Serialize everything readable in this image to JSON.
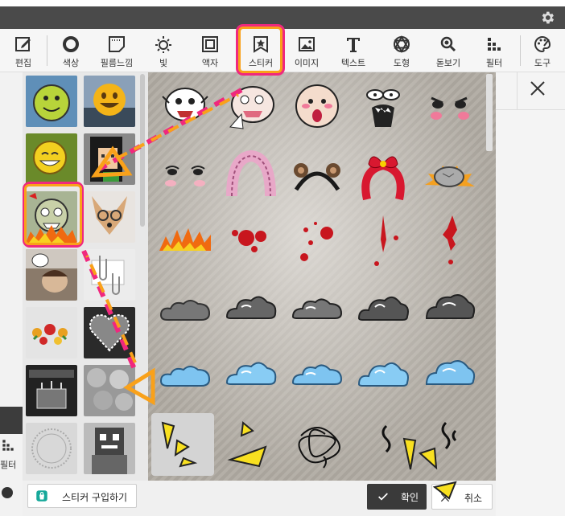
{
  "toolbar": {
    "items": [
      {
        "label": "편집",
        "icon": "edit-icon"
      },
      {
        "label": "색상",
        "icon": "color-circle-icon"
      },
      {
        "label": "필름느낌",
        "icon": "film-frame-icon"
      },
      {
        "label": "빛",
        "icon": "sun-icon"
      },
      {
        "label": "액자",
        "icon": "frame-icon"
      },
      {
        "label": "스티커",
        "icon": "sticker-star-icon"
      },
      {
        "label": "이미지",
        "icon": "image-icon"
      },
      {
        "label": "텍스트",
        "icon": "text-t-icon"
      },
      {
        "label": "도형",
        "icon": "shape-icon"
      },
      {
        "label": "돋보기",
        "icon": "magnifier-icon"
      },
      {
        "label": "필터",
        "icon": "filter-icon"
      },
      {
        "label": "도구",
        "icon": "palette-icon"
      }
    ],
    "selected": "스티커"
  },
  "left_rail": {
    "filter_label": "필터"
  },
  "thumbnail_panel": {
    "selected_index": 4,
    "items": [
      "smiley-green",
      "smiley-yellow-sunset",
      "smiley-yellow-thumbsup",
      "pixel-girl",
      "angry-face-flames",
      "chihuahua-glasses",
      "sad-boy",
      "paper-clips",
      "roses",
      "heart-frame",
      "birthday-cake",
      "gray-balls",
      "round-stamp",
      "pixel-robot"
    ]
  },
  "sticker_grid": {
    "rows": [
      [
        "crying-face-1",
        "crying-face-2",
        "bald-blush-face",
        "screaming-face",
        "blush-eyes-dark"
      ],
      [
        "blush-eyes",
        "pink-ruffle-band",
        "bear-ears-band",
        "red-ribbon-band",
        "rock-explosion"
      ],
      [
        "fire",
        "blood-splat-1",
        "blood-splat-2",
        "blood-drip-1",
        "blood-drip-2"
      ],
      [
        "gray-cloud-1",
        "gray-cloud-2",
        "gray-cloud-3",
        "gray-cloud-4",
        "gray-cloud-5"
      ],
      [
        "blue-cloud-1",
        "blue-cloud-2",
        "blue-cloud-3",
        "blue-cloud-4",
        "blue-cloud-5"
      ],
      [
        "yellow-shards-1",
        "yellow-shards-2",
        "scribble-ball",
        "squiggle-lines",
        "yellow-shards-3"
      ]
    ],
    "selected": "yellow-shards-1"
  },
  "bottom": {
    "buy_label": "스티커 구입하기",
    "ok_label": "확인",
    "cancel_label": "취소"
  },
  "colors": {
    "highlight_pink": "#f0287e",
    "highlight_orange": "#f9a11a",
    "title_bar": "#4a4a4a",
    "ok_button": "#3a3a3a"
  }
}
